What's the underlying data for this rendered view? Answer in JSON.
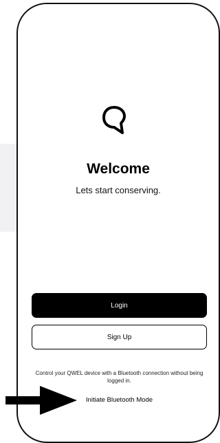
{
  "welcome": {
    "title": "Welcome",
    "subtitle": "Lets start conserving."
  },
  "actions": {
    "login_label": "Login",
    "signup_label": "Sign Up"
  },
  "bluetooth": {
    "description": "Control your QWEL device with a Bluetooth connection without being logged in.",
    "link_label": "Initiate Bluetooth Mode"
  },
  "icons": {
    "logo": "speech-bubble-logo-icon",
    "annotation": "arrow-right-icon"
  },
  "colors": {
    "primary": "#000000",
    "background": "#ffffff",
    "side_panel": "#f1f1f4"
  }
}
